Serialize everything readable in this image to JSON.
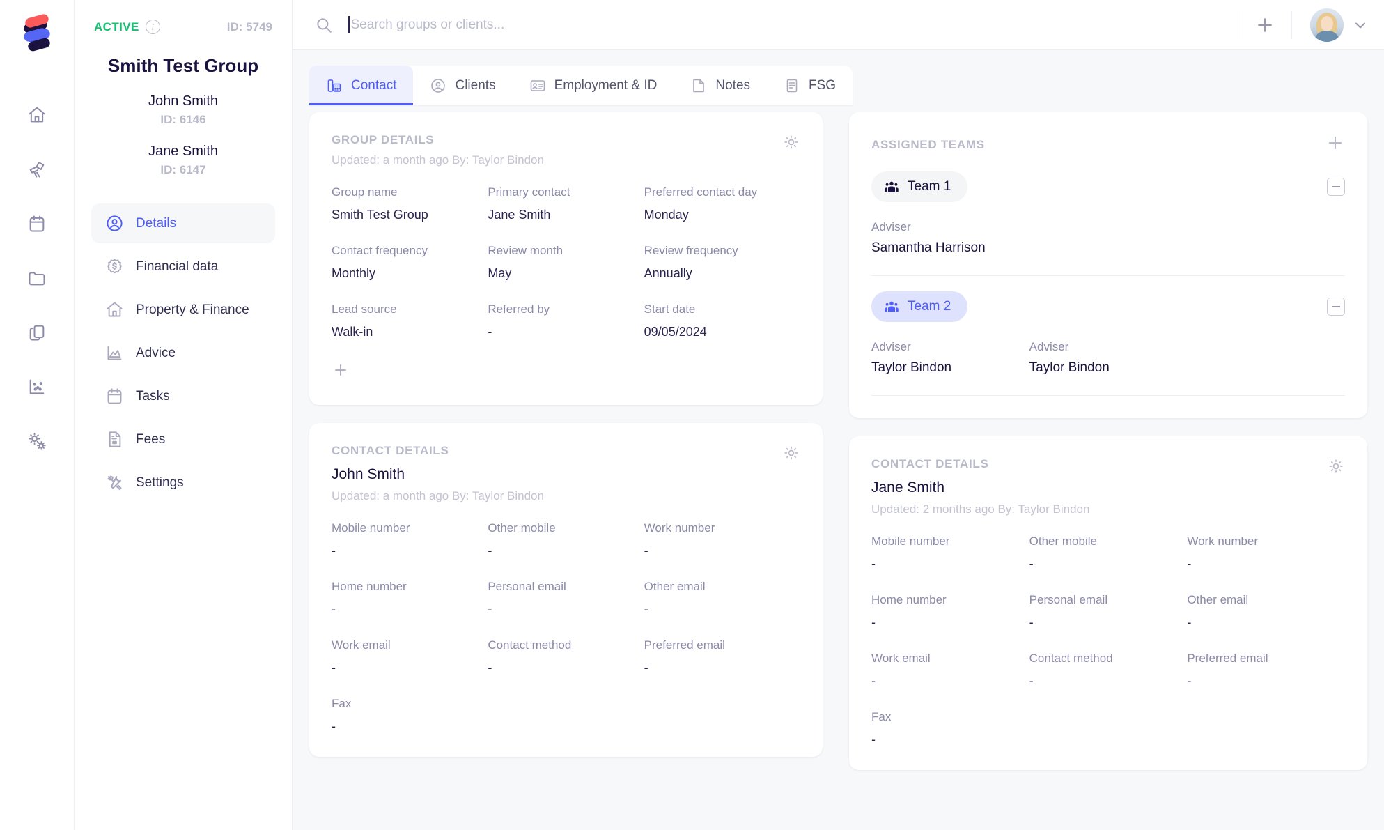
{
  "sidebar_rail": {
    "logo": "stacked-s-logo",
    "icons": [
      {
        "name": "home-icon"
      },
      {
        "name": "telescope-icon"
      },
      {
        "name": "calendar-icon"
      },
      {
        "name": "folder-icon"
      },
      {
        "name": "copy-icon"
      },
      {
        "name": "scatter-chart-icon"
      },
      {
        "name": "gears-icon"
      }
    ]
  },
  "context": {
    "status": "ACTIVE",
    "id_label": "ID: 5749",
    "group_title": "Smith Test Group",
    "members": [
      {
        "name": "John Smith",
        "id": "ID: 6146"
      },
      {
        "name": "Jane Smith",
        "id": "ID: 6147"
      }
    ],
    "nav": [
      {
        "label": "Details",
        "icon": "user-circle-icon",
        "active": true
      },
      {
        "label": "Financial data",
        "icon": "dollar-badge-icon",
        "active": false
      },
      {
        "label": "Property & Finance",
        "icon": "home-icon",
        "active": false
      },
      {
        "label": "Advice",
        "icon": "area-chart-icon",
        "active": false
      },
      {
        "label": "Tasks",
        "icon": "calendar-icon",
        "active": false
      },
      {
        "label": "Fees",
        "icon": "document-icon",
        "active": false
      },
      {
        "label": "Settings",
        "icon": "tools-icon",
        "active": false
      }
    ]
  },
  "topbar": {
    "search_placeholder": "Search groups or clients...",
    "search_value": "",
    "add_label": "+"
  },
  "tabs": [
    {
      "label": "Contact",
      "icon": "desk-phone-icon",
      "active": true
    },
    {
      "label": "Clients",
      "icon": "user-circle-icon",
      "active": false
    },
    {
      "label": "Employment & ID",
      "icon": "id-card-icon",
      "active": false
    },
    {
      "label": "Notes",
      "icon": "note-icon",
      "active": false
    },
    {
      "label": "FSG",
      "icon": "document-icon",
      "active": false
    }
  ],
  "group_details": {
    "title": "GROUP DETAILS",
    "updated": "Updated: a month ago By: Taylor Bindon",
    "fields": [
      {
        "label": "Group name",
        "value": "Smith Test Group"
      },
      {
        "label": "Primary contact",
        "value": "Jane Smith"
      },
      {
        "label": "Preferred contact day",
        "value": "Monday"
      },
      {
        "label": "Contact frequency",
        "value": "Monthly"
      },
      {
        "label": "Review month",
        "value": "May"
      },
      {
        "label": "Review frequency",
        "value": "Annually"
      },
      {
        "label": "Lead source",
        "value": "Walk-in"
      },
      {
        "label": "Referred by",
        "value": "-"
      },
      {
        "label": "Start date",
        "value": "09/05/2024"
      }
    ]
  },
  "contact_details_left": {
    "title": "CONTACT DETAILS",
    "person": "John Smith",
    "updated": "Updated: a month ago By: Taylor Bindon",
    "fields": [
      {
        "label": "Mobile number",
        "value": "-"
      },
      {
        "label": "Other mobile",
        "value": "-"
      },
      {
        "label": "Work number",
        "value": "-"
      },
      {
        "label": "Home number",
        "value": "-"
      },
      {
        "label": "Personal email",
        "value": "-"
      },
      {
        "label": "Other email",
        "value": "-"
      },
      {
        "label": "Work email",
        "value": "-"
      },
      {
        "label": "Contact method",
        "value": "-"
      },
      {
        "label": "Preferred email",
        "value": "-"
      },
      {
        "label": "Fax",
        "value": "-"
      }
    ]
  },
  "assigned_teams": {
    "title": "ASSIGNED TEAMS",
    "teams": [
      {
        "name": "Team 1",
        "selected": false,
        "advisers": [
          {
            "label": "Adviser",
            "name": "Samantha Harrison"
          }
        ]
      },
      {
        "name": "Team 2",
        "selected": true,
        "advisers": [
          {
            "label": "Adviser",
            "name": "Taylor Bindon"
          },
          {
            "label": "Adviser",
            "name": "Taylor Bindon"
          }
        ]
      }
    ]
  },
  "contact_details_right": {
    "title": "CONTACT DETAILS",
    "person": "Jane Smith",
    "updated": "Updated: 2 months ago By: Taylor Bindon",
    "fields": [
      {
        "label": "Mobile number",
        "value": "-"
      },
      {
        "label": "Other mobile",
        "value": "-"
      },
      {
        "label": "Work number",
        "value": "-"
      },
      {
        "label": "Home number",
        "value": "-"
      },
      {
        "label": "Personal email",
        "value": "-"
      },
      {
        "label": "Other email",
        "value": "-"
      },
      {
        "label": "Work email",
        "value": "-"
      },
      {
        "label": "Contact method",
        "value": "-"
      },
      {
        "label": "Preferred email",
        "value": "-"
      },
      {
        "label": "Fax",
        "value": "-"
      }
    ]
  },
  "colors": {
    "accent": "#4f5ef7",
    "active_green": "#16c172",
    "dark_text": "#1b1240",
    "muted": "#b9bac9",
    "page_bg": "#f7f8fa"
  }
}
